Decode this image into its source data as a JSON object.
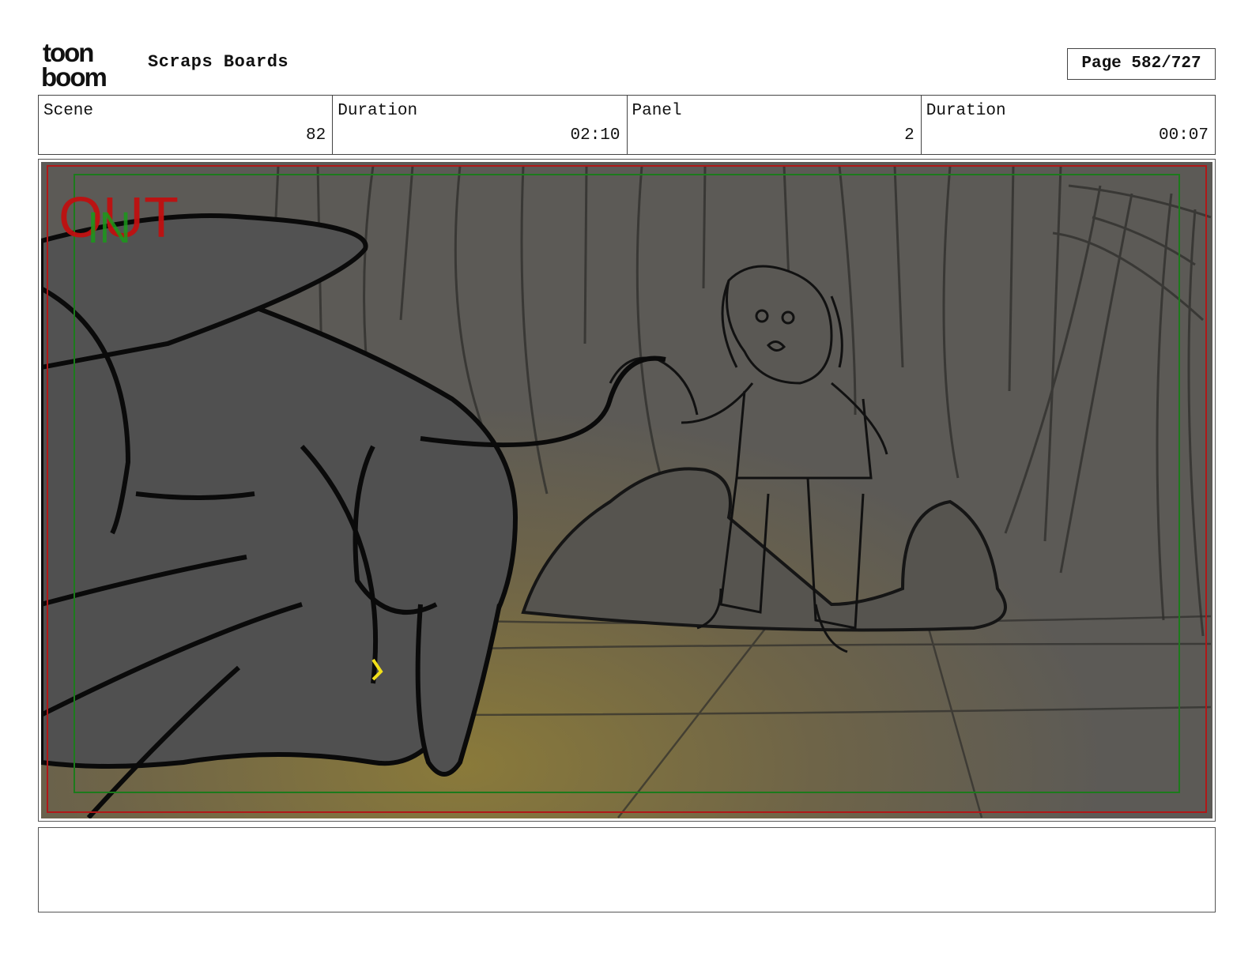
{
  "header": {
    "logo_top": "toon",
    "logo_bottom": "boom",
    "app_title": "Scraps Boards",
    "page": "Page 582/727"
  },
  "info": {
    "scene_label": "Scene",
    "scene_value": "82",
    "scene_duration_label": "Duration",
    "scene_duration_value": "02:10",
    "panel_label": "Panel",
    "panel_value": "2",
    "panel_duration_label": "Duration",
    "panel_duration_value": "00:07"
  },
  "frame": {
    "out_marker": "OUT",
    "in_marker": "IN",
    "colors": {
      "out": "#c01010",
      "in": "#1a9a1a",
      "safe_frame": "#1c7a1c",
      "action_frame": "#b01818",
      "panel_bg": "#5c5a56",
      "glow": "#8a7a3a"
    }
  },
  "notes": {
    "text": ""
  }
}
